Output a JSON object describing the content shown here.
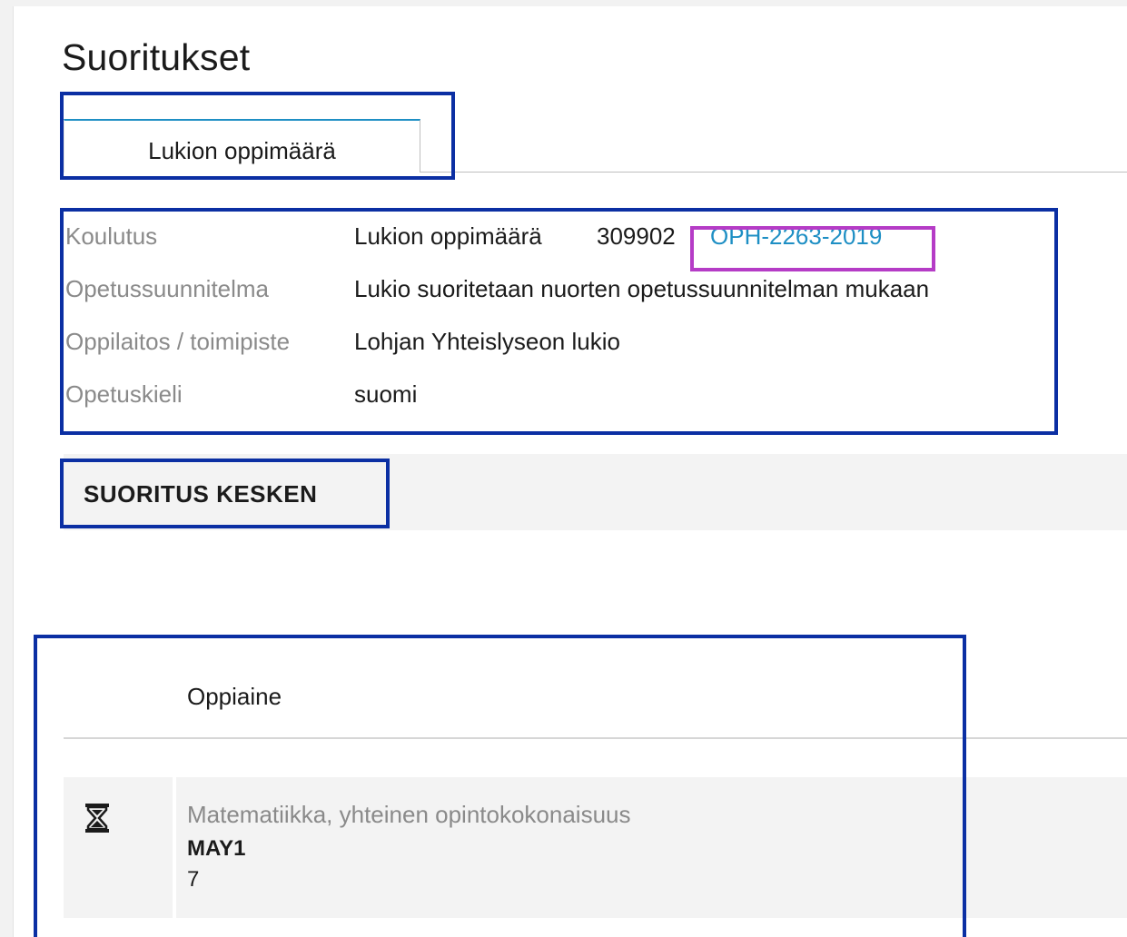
{
  "page": {
    "title": "Suoritukset"
  },
  "tabs": [
    {
      "label": "Lukion oppimäärä",
      "active": true
    }
  ],
  "info": {
    "koulutus": {
      "label": "Koulutus",
      "value": "Lukion oppimäärä",
      "code": "309902",
      "diaari": "OPH-2263-2019"
    },
    "opetussuunnitelma": {
      "label": "Opetussuunnitelma",
      "value": "Lukio suoritetaan nuorten opetussuunnitelman mukaan"
    },
    "oppilaitos": {
      "label": "Oppilaitos / toimipiste",
      "value": "Lohjan Yhteislyseon lukio"
    },
    "opetuskieli": {
      "label": "Opetuskieli",
      "value": "suomi"
    }
  },
  "status": {
    "label": "SUORITUS KESKEN"
  },
  "table": {
    "column_header": "Oppiaine",
    "rows": [
      {
        "status_icon": "hourglass-icon",
        "subject": "Matematiikka, yhteinen opintokokonaisuus",
        "course_code": "MAY1",
        "grade": "7"
      }
    ]
  },
  "colors": {
    "link": "#1e8fc4",
    "highlight_box": "#0b2fa3",
    "highlight_link": "#b53cc6",
    "row_background": "#f3f3f3",
    "label_gray": "#8a8a8a"
  }
}
